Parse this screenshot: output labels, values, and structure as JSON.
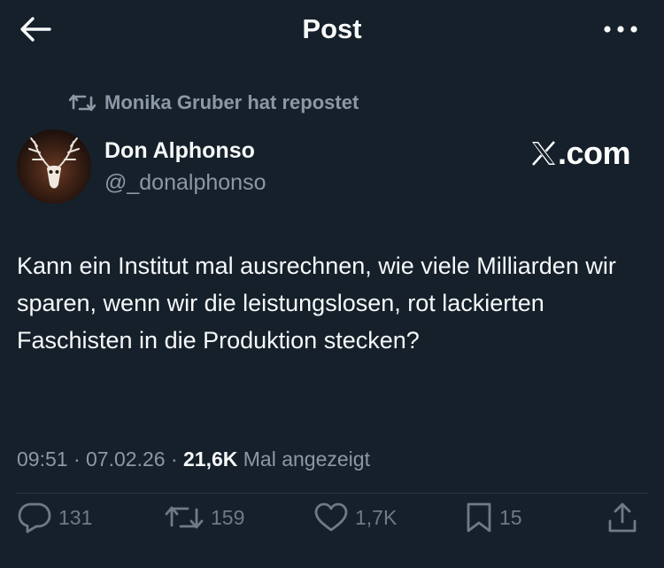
{
  "header": {
    "title": "Post"
  },
  "repost": {
    "label": "Monika Gruber hat repostet"
  },
  "author": {
    "name": "Don Alphonso",
    "handle": "@_donalphonso"
  },
  "watermark": {
    "suffix": ".com"
  },
  "tweet": {
    "text": "Kann ein Institut mal ausrechnen, wie viele Milliarden wir sparen, wenn wir die leistungslosen, rot lackierten Faschisten in die Produktion stecken?",
    "time": "09:51",
    "date": "07.02.26",
    "views": "21,6K",
    "views_label": "Mal angezeigt"
  },
  "actions": {
    "replies": "131",
    "reposts": "159",
    "likes": "1,7K",
    "bookmarks": "15"
  },
  "icons": {
    "back": "arrow-left-icon",
    "more": "more-dots-icon",
    "repost": "repost-icon",
    "reply": "reply-icon",
    "like": "heart-icon",
    "bookmark": "bookmark-icon",
    "share": "share-icon"
  },
  "colors": {
    "background": "#15202b",
    "text": "#f7f9f9",
    "muted": "#8b98a5",
    "action": "#6e7b87"
  }
}
